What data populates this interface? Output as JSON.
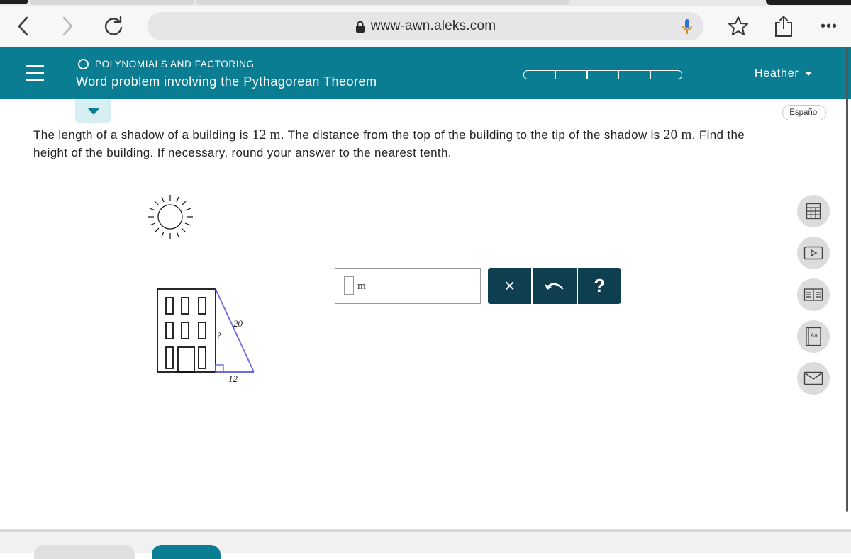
{
  "browser": {
    "url": "www-awn.aleks.com",
    "more_label": "•••"
  },
  "header": {
    "topic": "POLYNOMIALS AND FACTORING",
    "title": "Word problem involving the Pythagorean Theorem",
    "user": "Heather",
    "progress_segments": 5
  },
  "language_button": "Español",
  "problem": {
    "p1": "The length of a shadow of a building is ",
    "shadow": "12 m",
    "p2": ". The distance from the top of the building to the tip of the shadow is ",
    "distance": "20 m",
    "p3": ". Find the height of the building. If necessary, round your answer to the nearest tenth."
  },
  "figure": {
    "hypotenuse_label": "20",
    "height_label": "?",
    "base_label": "12",
    "triangle_color": "#6b6be0"
  },
  "answer": {
    "unit": "m"
  },
  "actions": {
    "clear": "×",
    "help": "?"
  },
  "tools": [
    "calculator-icon",
    "video-icon",
    "ebook-icon",
    "dictionary-icon",
    "message-icon"
  ],
  "colors": {
    "header": "#0b7d92",
    "action_bg": "#0e3f50"
  }
}
